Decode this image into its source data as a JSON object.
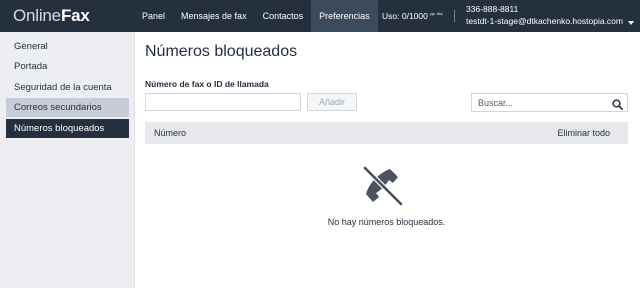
{
  "app": {
    "logo_part1": "Online",
    "logo_part2": "Fax"
  },
  "nav": {
    "items": [
      {
        "label": "Panel"
      },
      {
        "label": "Mensajes de fax"
      },
      {
        "label": "Contactos"
      },
      {
        "label": "Preferencias",
        "active": true
      }
    ]
  },
  "usage": {
    "label": "Uso:",
    "value": "0/1000",
    "unit": "pp. día"
  },
  "account": {
    "number": "336-888-8811",
    "email": "testdt-1-stage@dtkachenko.hostopia.com"
  },
  "sidebar": {
    "items": [
      {
        "label": "General"
      },
      {
        "label": "Portada"
      },
      {
        "label": "Seguridad de la cuenta"
      },
      {
        "label": "Correos secundarios",
        "state": "highlighted"
      },
      {
        "label": "Números bloqueados",
        "state": "active"
      }
    ]
  },
  "main": {
    "title": "Números bloqueados",
    "field_label": "Número de fax o ID de llamada",
    "fax_input_value": "",
    "add_button": "Añadir",
    "search_placeholder": "Buscar...",
    "table": {
      "col_number": "Número",
      "delete_all": "Eliminar todo"
    },
    "empty_message": "No hay números bloqueados.",
    "empty_icon": "phone-blocked-icon"
  },
  "colors": {
    "topbar": "#25303f",
    "nav_active": "#3c4a5d",
    "sidebar_bg": "#eceef1",
    "sidebar_active": "#25303f",
    "sidebar_highlight": "#c7cdd6",
    "table_header": "#e6e8eb",
    "icon": "#4b535e"
  }
}
